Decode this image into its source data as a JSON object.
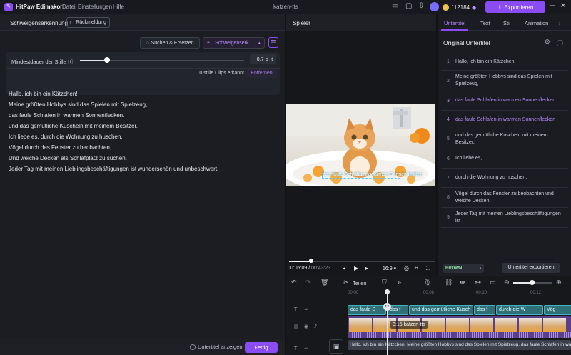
{
  "titlebar": {
    "app_name": "HitPaw Edimakor",
    "menu": [
      "Datei",
      "Einstellungen",
      "Hilfe"
    ],
    "project_name": "katzen-tts",
    "credits": "112184",
    "export_label": "Exportieren"
  },
  "left_panel": {
    "title": "Schweigenserkennung",
    "feedback_label": "Rückmeldung",
    "search_replace_label": "Suchen & Ersetzen",
    "silence_dropdown_label": "Schweigenserk...",
    "min_duration_label": "Mindestdauer der Stille",
    "min_duration_value": "0.7",
    "min_duration_unit": "s",
    "slider_fraction": 0.16,
    "clips_detected": "0 stille Clips erkannt",
    "remove_label": "Entfernen",
    "transcript": [
      "Hallo, ich bin ein Kätzchen!",
      "Meine größten Hobbys sind das Spielen mit Spielzeug,",
      "das faule Schlafen in warmen Sonnenflecken.",
      "und das gemütliche Kuscheln mit meinem Besitzer.",
      "Ich liebe es, durch die Wohnung zu huschen,",
      "Vögel durch das Fenster zu beobachten,",
      "Und weiche Decken als Schlafplatz zu suchen.",
      "Jeder Tag mit meinen Lieblingsbeschäftigungen ist wunderschön und unbeschwert."
    ],
    "show_subtitles_label": "Untertitel anzeigen",
    "done_label": "Fertig"
  },
  "player": {
    "title": "Spieler",
    "subtitle_on_video": "das faule Schlafen in warmen Sonnenflecken",
    "current_time": "00:05:09",
    "total_time": "00:43:23",
    "aspect_ratio": "16:9",
    "progress_fraction": 0.12
  },
  "right_panel": {
    "tabs": [
      "Untertitel",
      "Text",
      "Stil",
      "Animation"
    ],
    "section_title": "Original Untertitel",
    "subtitles": [
      {
        "num": "1",
        "text": "Hallo, ich bin ein Kätzchen!",
        "active": false
      },
      {
        "num": "2",
        "text": "Meine größten Hobbys sind das Spielen mit Spielzeug,",
        "active": false
      },
      {
        "num": "3",
        "text": "das faule Schlafen in warmen Sonnenflecken",
        "active": true
      },
      {
        "num": "4",
        "text": "das faule Schlafen in warmen Sonnenflecken",
        "active": true
      },
      {
        "num": "5",
        "text": "und das gemütliche Kuscheln mit meinem Besitzer.",
        "active": false
      },
      {
        "num": "6",
        "text": "Ich liebe es,",
        "active": false
      },
      {
        "num": "7",
        "text": "durch die Wohnung zu huschen,",
        "active": false
      },
      {
        "num": "8",
        "text": "Vögel durch das Fenster zu beobachten und weiche Decken",
        "active": false
      },
      {
        "num": "9",
        "text": "Jeder Tag mit meinen Lieblingsbeschäftigungen ist",
        "active": false
      }
    ],
    "style_preset": "BROWN",
    "export_subtitles_label": "Untertitel exportieren"
  },
  "timeline": {
    "split_label": "Teilen",
    "ruler_ticks": [
      "00:00",
      "00:08",
      "00:10",
      "00:12"
    ],
    "subtitle_clips": [
      "das faule S",
      "das f",
      "und das gemütliche Kusch",
      "das f",
      "durch die W",
      "Vög"
    ],
    "video_clip_label": "0:15 katzen-tts",
    "text_track": "Hallo, ich bin ein Kätzchen! Meine größten Hobbys sind das Spielen mit Spielzeug, das faule Schlafen in warmen Sonnenflecken.",
    "zoom_fraction": 0.47
  }
}
